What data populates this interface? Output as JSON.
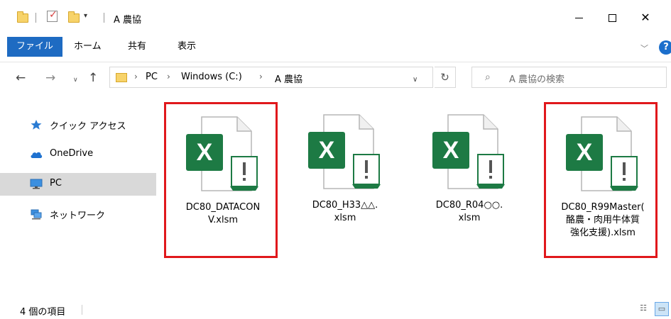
{
  "window": {
    "title": "A 農協"
  },
  "ribbon": {
    "tabs": [
      "ファイル",
      "ホーム",
      "共有",
      "表示"
    ]
  },
  "nav": {
    "breadcrumb": [
      "PC",
      "Windows (C:)",
      "A 農協"
    ],
    "search_placeholder": "A 農協の検索"
  },
  "sidebar": {
    "items": [
      {
        "label": "クイック アクセス",
        "icon": "star-icon"
      },
      {
        "label": "OneDrive",
        "icon": "cloud-icon"
      },
      {
        "label": "PC",
        "icon": "monitor-icon",
        "selected": true
      },
      {
        "label": "ネットワーク",
        "icon": "network-icon"
      }
    ]
  },
  "files": [
    {
      "name": "DC80_DATACONV.xlsm",
      "display_lines": [
        "DC80_DATACON",
        "V.xlsm"
      ],
      "flagged": true
    },
    {
      "name": "DC80_H33△△.xlsm",
      "display_lines": [
        "DC80_H33△△.",
        "xlsm"
      ],
      "flagged": false
    },
    {
      "name": "DC80_R04○○.xlsm",
      "display_lines": [
        "DC80_R04○○.",
        "xlsm"
      ],
      "flagged": false
    },
    {
      "name": "DC80_R99Master(酪農・肉用牛体質強化支援).xlsm",
      "display_lines": [
        "DC80_R99Master(",
        "酪農・肉用牛体質",
        "強化支援).xlsm"
      ],
      "flagged": true
    }
  ],
  "status": {
    "item_count": "4 個の項目"
  },
  "colors": {
    "accent": "#1e6bc2",
    "excel_green": "#1d7a44",
    "highlight_border": "#e0181c",
    "selected_bg": "#d9d9d9"
  }
}
